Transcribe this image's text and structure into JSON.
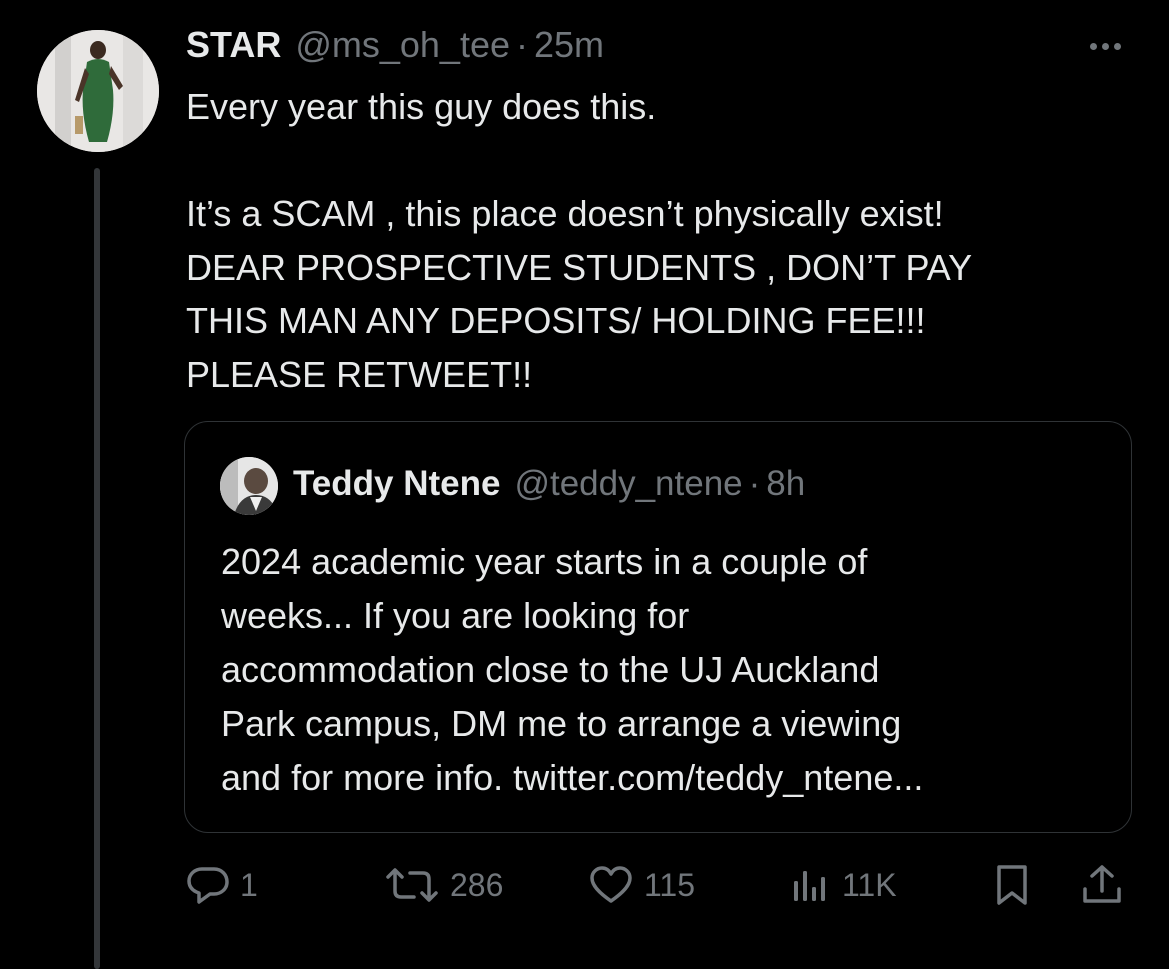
{
  "tweet": {
    "display_name": "STAR",
    "handle": "@ms_oh_tee",
    "separator": "·",
    "time": "25m",
    "text_lines": [
      "Every year this guy does this.",
      "",
      "It’s a SCAM , this place doesn’t physically exist!",
      "DEAR PROSPECTIVE STUDENTS , DON’T PAY",
      "THIS MAN ANY DEPOSITS/ HOLDING FEE!!!",
      "PLEASE RETWEET!!"
    ]
  },
  "quote": {
    "display_name": "Teddy Ntene",
    "handle": "@teddy_ntene",
    "separator": "·",
    "time": "8h",
    "text_lines": [
      "2024 academic year starts in a couple of",
      "weeks... If you are looking for",
      "accommodation close to the UJ Auckland",
      "Park campus, DM me to arrange a viewing",
      "and for more info. twitter.com/teddy_ntene..."
    ]
  },
  "actions": {
    "reply_count": "1",
    "retweet_count": "286",
    "like_count": "115",
    "view_count": "11K"
  },
  "icons": {
    "more": "more-icon",
    "reply": "reply-icon",
    "retweet": "retweet-icon",
    "like": "heart-icon",
    "views": "views-icon",
    "bookmark": "bookmark-icon",
    "share": "share-icon"
  },
  "colors": {
    "background": "#000000",
    "text": "#e7e9ea",
    "secondary": "#71767b",
    "border": "#2f3336"
  }
}
